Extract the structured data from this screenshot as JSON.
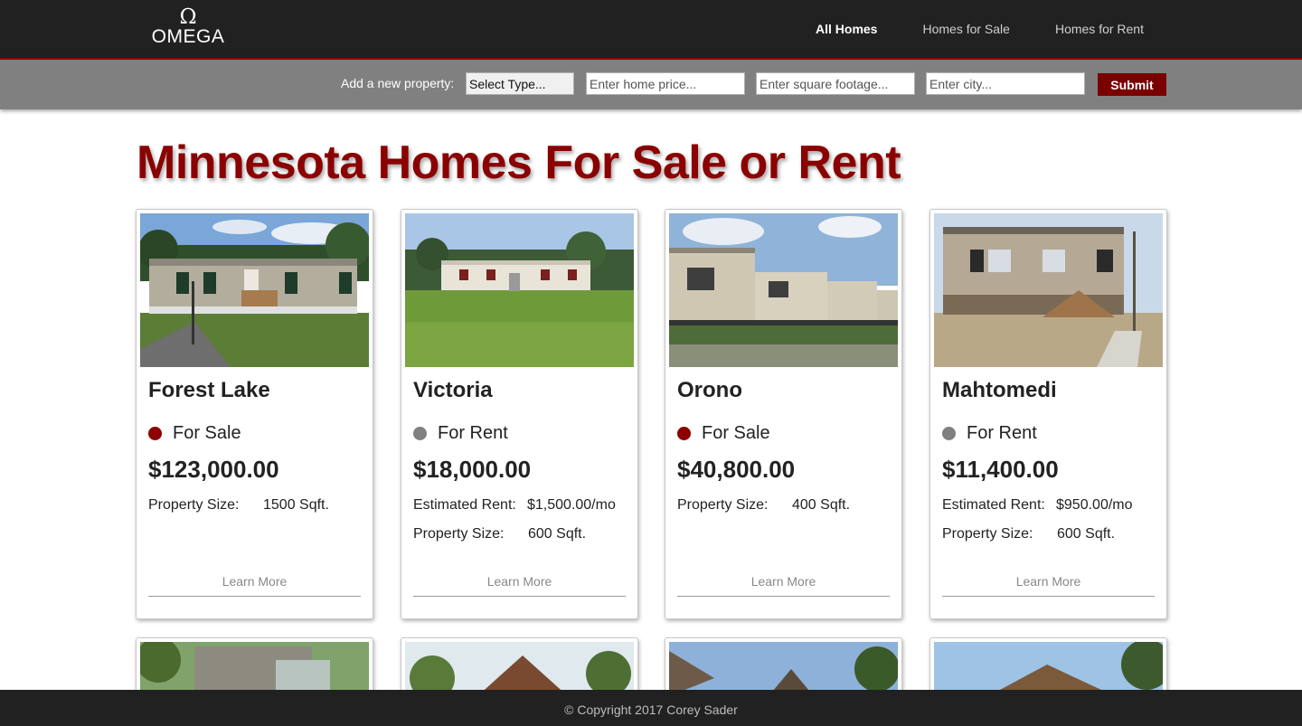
{
  "brand": {
    "symbol": "Ω",
    "name": "OMEGA"
  },
  "nav": {
    "links": [
      "All Homes",
      "Homes for Sale",
      "Homes for Rent"
    ],
    "active": "All Homes"
  },
  "add_form": {
    "label": "Add a new property:",
    "type_select": "Select Type...",
    "price_placeholder": "Enter home price...",
    "sqft_placeholder": "Enter square footage...",
    "city_placeholder": "Enter city...",
    "submit_label": "Submit"
  },
  "page_title": "Minnesota Homes For Sale or Rent",
  "colors": {
    "accent": "#8b0000",
    "for_sale_dot": "#8b0000",
    "for_rent_dot": "#808080",
    "nav_bg": "#212121",
    "form_bg": "#808080"
  },
  "listings": [
    {
      "city": "Forest Lake",
      "status": "For Sale",
      "price": "$123,000.00",
      "rent_label": "",
      "rent_value": "",
      "size_label": "Property Size:",
      "size_value": "1500 Sqft.",
      "learn_more": "Learn More"
    },
    {
      "city": "Victoria",
      "status": "For Rent",
      "price": "$18,000.00",
      "rent_label": "Estimated Rent:",
      "rent_value": "$1,500.00/mo",
      "size_label": "Property Size:",
      "size_value": "600 Sqft.",
      "learn_more": "Learn More"
    },
    {
      "city": "Orono",
      "status": "For Sale",
      "price": "$40,800.00",
      "rent_label": "",
      "rent_value": "",
      "size_label": "Property Size:",
      "size_value": "400 Sqft.",
      "learn_more": "Learn More"
    },
    {
      "city": "Mahtomedi",
      "status": "For Rent",
      "price": "$11,400.00",
      "rent_label": "Estimated Rent:",
      "rent_value": "$950.00/mo",
      "size_label": "Property Size:",
      "size_value": "600 Sqft.",
      "learn_more": "Learn More"
    }
  ],
  "footer": {
    "copyright": "© Copyright 2017 Corey Sader"
  }
}
